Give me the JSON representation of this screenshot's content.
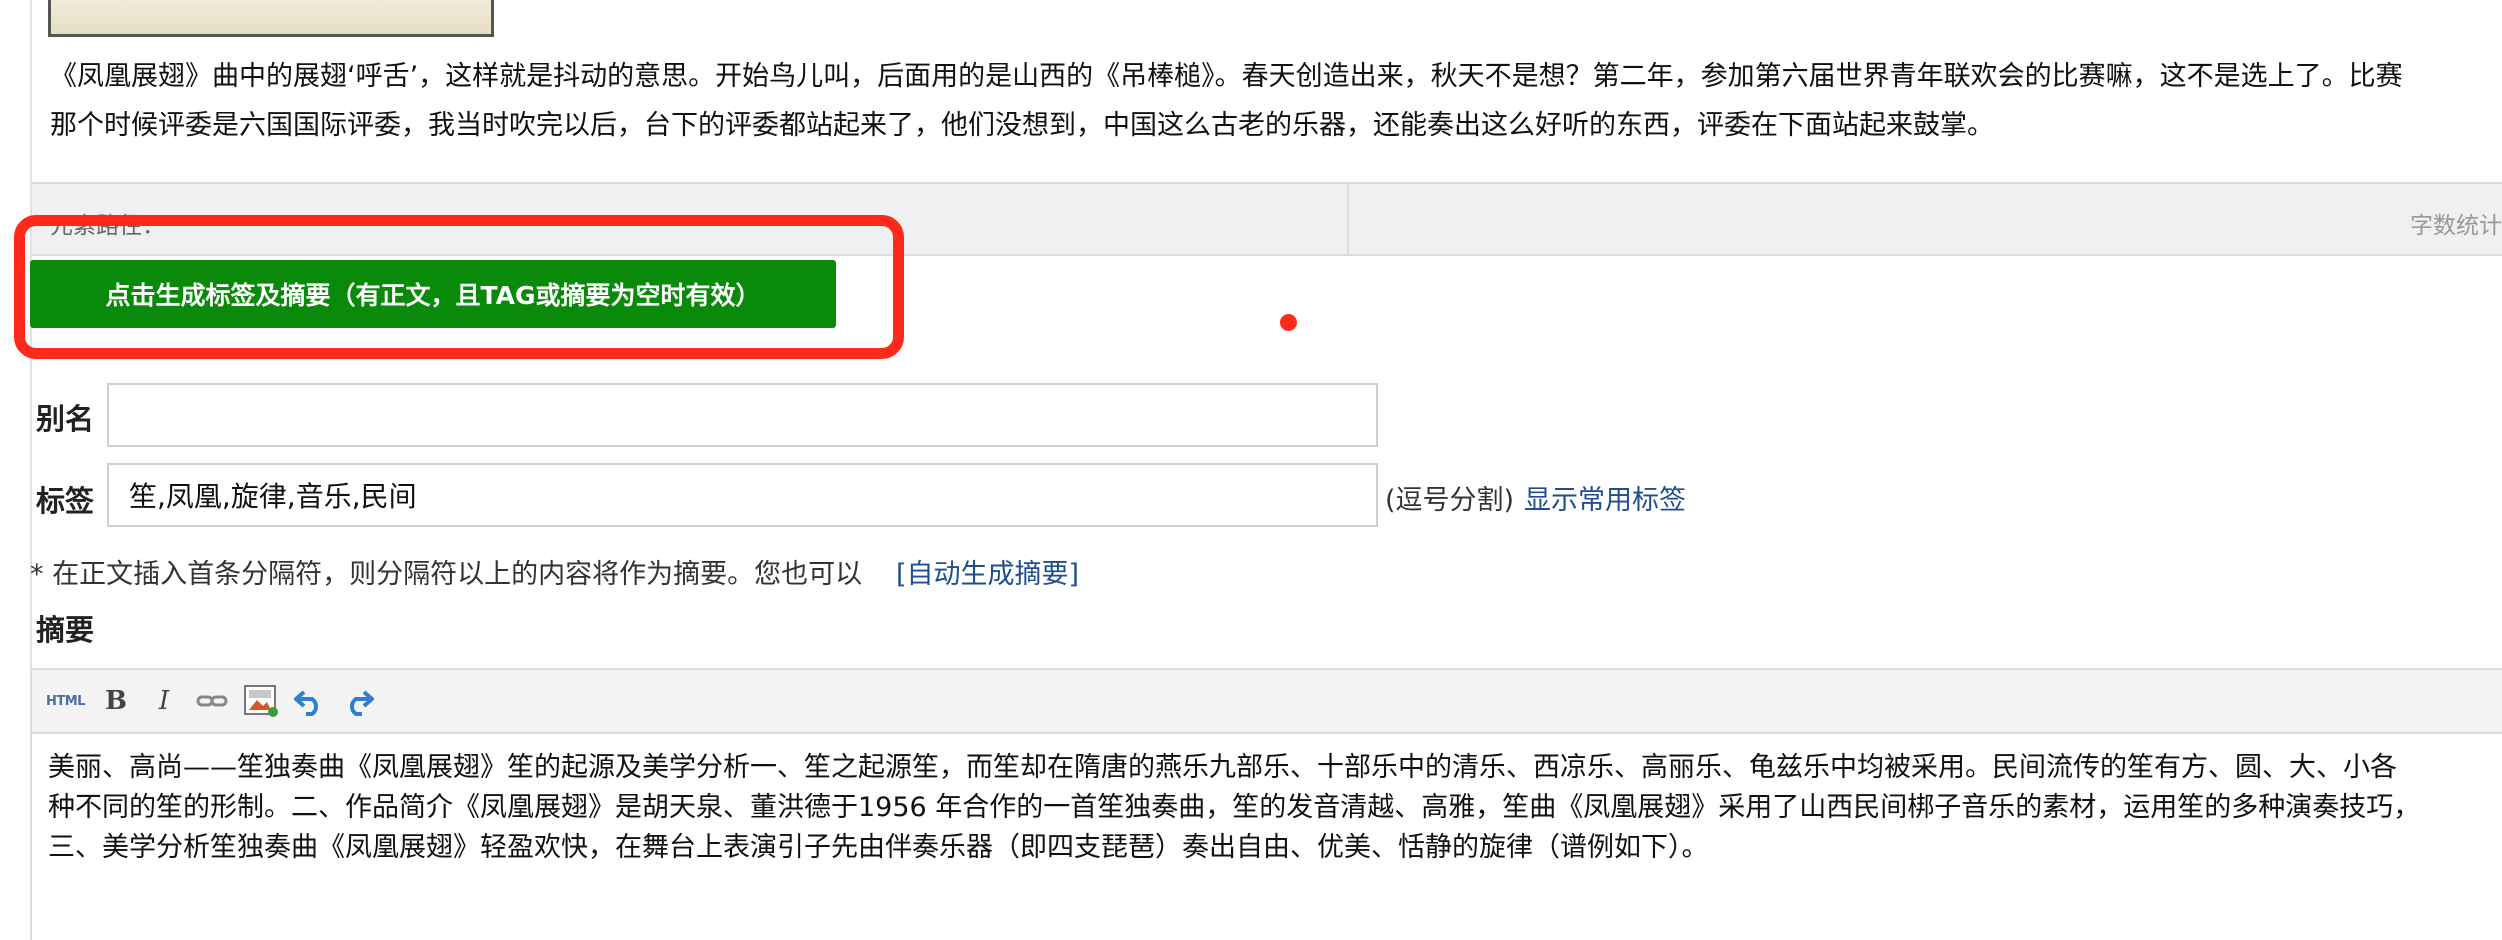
{
  "content": {
    "lines": [
      "《凤凰展翅》曲中的展翅‘呼舌’，这样就是抖动的意思。开始鸟儿叫，后面用的是山西的《吊棒槌》。春天创造出来，秋天不是想？第二年，参加第六届世界青年联欢会的比赛嘛，这不是选上了。比赛",
      "那个时候评委是六国国际评委，我当时吹完以后，台下的评委都站起来了，他们没想到，中国这么古老的乐器，还能奏出这么好听的东西，评委在下面站起来鼓掌。"
    ]
  },
  "status_bar": {
    "path_label": "元素路径：",
    "word_count_label": "字数统计"
  },
  "generate_button": {
    "label": "点击生成标签及摘要（有正文，且TAG或摘要为空时有效）"
  },
  "alias": {
    "label": "别名",
    "value": ""
  },
  "tags": {
    "label": "标签",
    "value": "笙,凤凰,旋律,音乐,民间",
    "hint": "(逗号分割)",
    "show_common_link": "显示常用标签"
  },
  "summary_hint": {
    "text": "* 在正文插入首条分隔符，则分隔符以上的内容将作为摘要。您也可以",
    "link": "[自动生成摘要]"
  },
  "summary": {
    "label": "摘要",
    "toolbar": {
      "html_label": "HTML",
      "bold_label": "B",
      "italic_label": "I"
    },
    "lines": [
      "美丽、高尚——笙独奏曲《凤凰展翅》笙的起源及美学分析一、笙之起源笙，而笙却在隋唐的燕乐九部乐、十部乐中的清乐、西凉乐、高丽乐、龟兹乐中均被采用。民间流传的笙有方、圆、大、小各",
      "种不同的笙的形制。二、作品简介《凤凰展翅》是胡天泉、董洪德于1956 年合作的一首笙独奏曲，笙的发音清越、高雅，笙曲《凤凰展翅》采用了山西民间梆子音乐的素材，运用笙的多种演奏技巧，",
      "三、美学分析笙独奏曲《凤凰展翅》轻盈欢快，在舞台上表演引子先由伴奏乐器（即四支琵琶）奏出自由、优美、恬静的旋律（谱例如下）。"
    ]
  },
  "colors": {
    "button_green": "#0a8a0a",
    "highlight_red": "#ff2a1a",
    "link_blue": "#1f4f8f"
  }
}
